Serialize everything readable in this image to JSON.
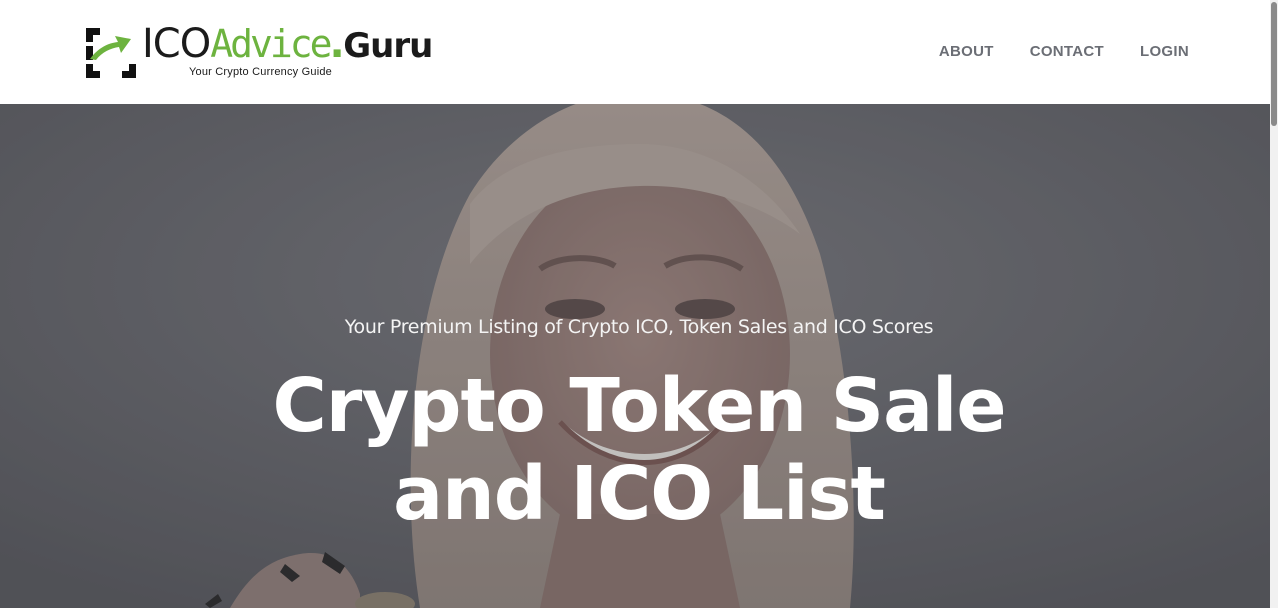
{
  "brand": {
    "part_ico": "ICO",
    "part_advice": "Advice",
    "part_dot": ".",
    "part_guru": "Guru",
    "tagline": "Your Crypto Currency Guide",
    "mark_icon": "arrow-bracket-logo-icon",
    "accent_color": "#6db33f"
  },
  "nav": {
    "items": [
      {
        "label": "ABOUT"
      },
      {
        "label": "CONTACT"
      },
      {
        "label": "LOGIN"
      }
    ]
  },
  "hero": {
    "subtitle": "Your Premium Listing of Crypto ICO, Token Sales and ICO Scores",
    "title_line1": "Crypto Token Sale",
    "title_line2": "and ICO List"
  }
}
